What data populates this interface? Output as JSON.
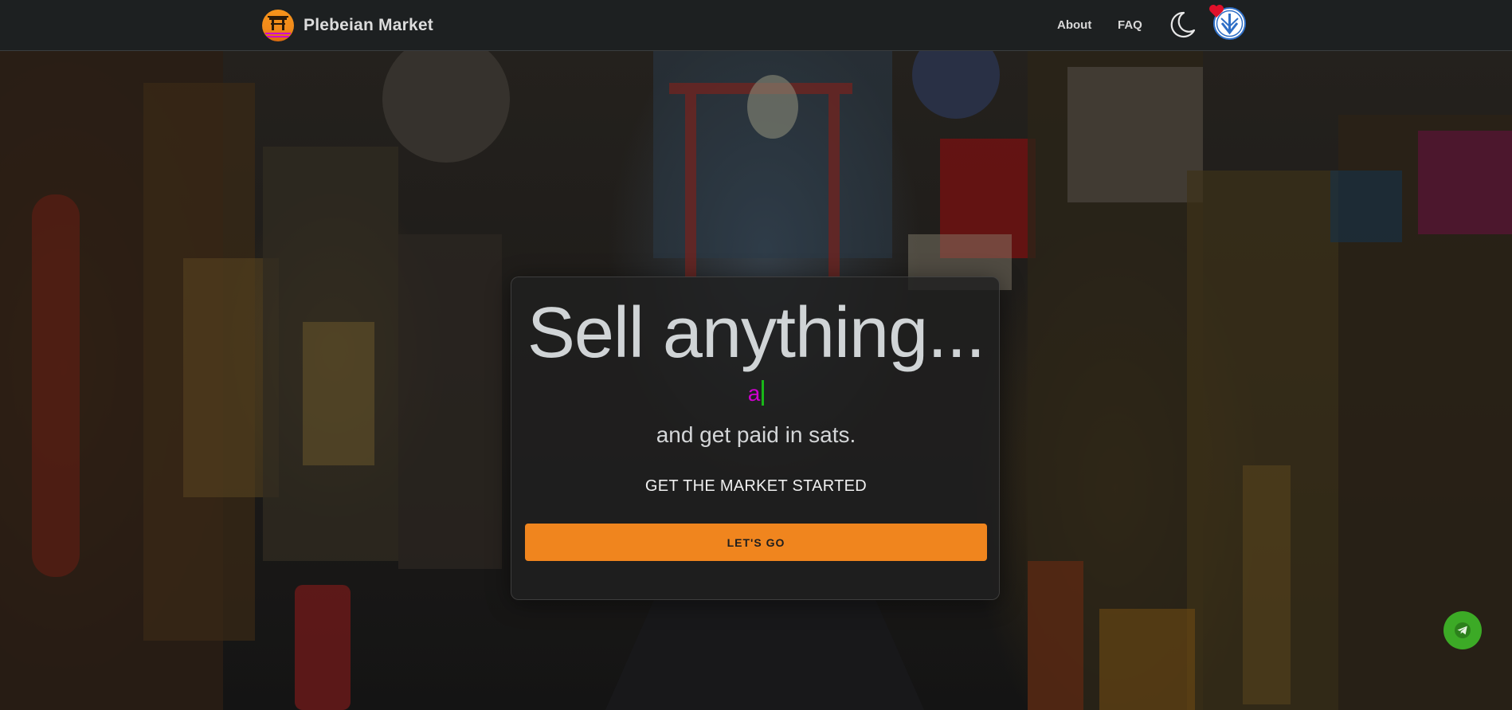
{
  "header": {
    "brand_name": "Plebeian Market",
    "nav": [
      {
        "label": "About"
      },
      {
        "label": "FAQ"
      }
    ],
    "theme_toggle_icon": "moon-icon",
    "avatar_icon": "user-avatar-icon",
    "notification_icon": "heart-badge-icon"
  },
  "hero": {
    "headline": "Sell anything...",
    "typing_text": "a",
    "subline": "and get paid in sats.",
    "cta_title": "GET THE MARKET STARTED",
    "cta_button": "LET'S GO"
  },
  "floating": {
    "telegram_icon": "telegram-icon"
  },
  "colors": {
    "accent": "#f0851e",
    "typing": "#d000d0",
    "cursor": "#19b619",
    "telegram": "#3caa26",
    "header_bg": "#1d2021"
  }
}
